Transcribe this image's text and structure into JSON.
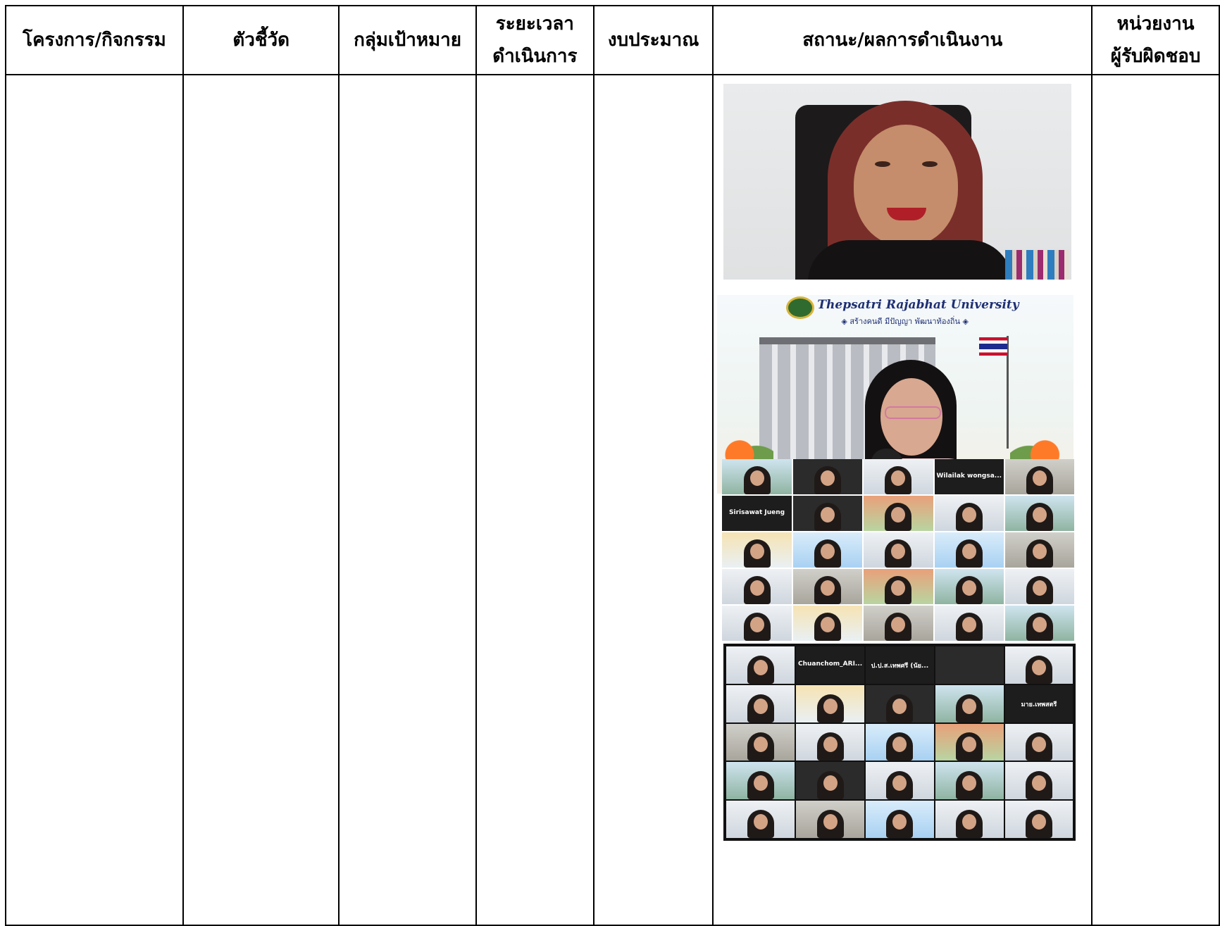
{
  "table": {
    "headers": {
      "project": "โครงการ/กิจกรรม",
      "indicator": "ตัวชี้วัด",
      "target_group": "กลุ่มเป้าหมาย",
      "duration_line1": "ระยะเวลา",
      "duration_line2": "ดำเนินการ",
      "budget": "งบประมาณ",
      "status": "สถานะ/ผลการดำเนินงาน",
      "responsible_line1": "หน่วยงาน",
      "responsible_line2": "ผู้รับผิดชอบ"
    }
  },
  "photos": {
    "university_banner": {
      "name": "Thepsatri Rajabhat University",
      "motto": "◈ สร้างคนดี มีปัญญา พัฒนาท้องถิ่น ◈"
    },
    "meeting_grid_1": {
      "name_tiles": [
        "Wilailak wongsa...",
        "Sirisawat Jueng"
      ]
    },
    "meeting_grid_2": {
      "name_tiles": [
        "Chuanchom_ARI...",
        "ป.ป.ส.เทพศรี (นัย...",
        "มาย.เทพสตรี"
      ]
    }
  }
}
